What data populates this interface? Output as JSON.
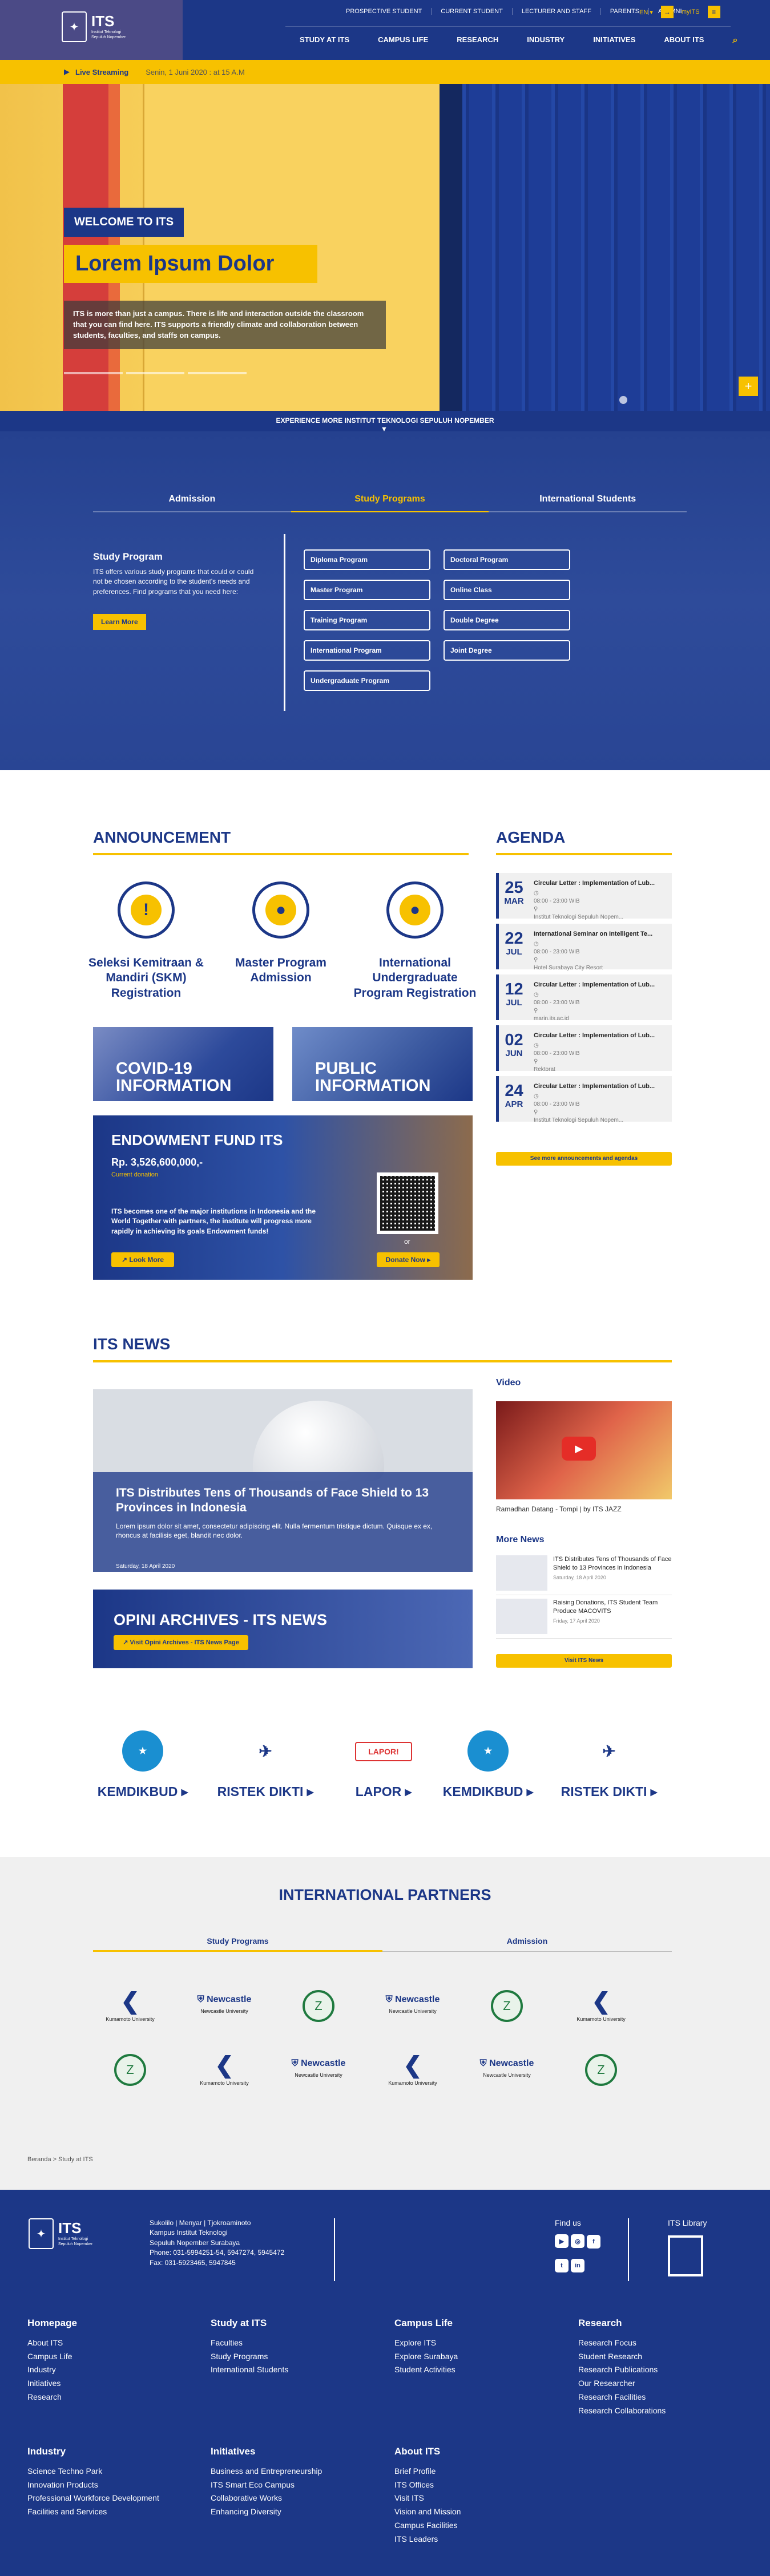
{
  "header": {
    "logo": {
      "text": "ITS",
      "sub": "Institut Teknologi Sepuluh Nopember"
    },
    "top_links": [
      "PROSPECTIVE STUDENT",
      "CURRENT STUDENT",
      "LECTURER AND STAFF",
      "PARENTS",
      "ALUMNI"
    ],
    "lang": "EN",
    "myits": "myITS",
    "main_nav": [
      "STUDY AT ITS",
      "CAMPUS LIFE",
      "RESEARCH",
      "INDUSTRY",
      "INITIATIVES",
      "ABOUT ITS"
    ]
  },
  "live": {
    "label": "Live Streaming",
    "event": "Senin, 1 Juni 2020 : at 15 A.M"
  },
  "hero": {
    "welcome": "WELCOME TO ITS",
    "title": "Lorem Ipsum Dolor",
    "desc": "ITS is more than just a campus. There is life and interaction outside the classroom that you can find here. ITS supports a friendly climate and collaboration between students, faculties, and staffs on campus.",
    "explore": "EXPERIENCE MORE INSTITUT TEKNOLOGI SEPULUH NOPEMBER"
  },
  "programs": {
    "tabs": [
      "Admission",
      "Study Programs",
      "International Students"
    ],
    "title": "Study Program",
    "desc": "ITS offers various study programs that could or could not be chosen according to the student's needs and preferences. Find programs that you need here:",
    "learn": "Learn More",
    "items": [
      "Diploma Program",
      "Doctoral Program",
      "Master Program",
      "Online Class",
      "Training Program",
      "Double Degree",
      "International Program",
      "Joint Degree",
      "Undergraduate Program"
    ]
  },
  "announcement": {
    "title": "ANNOUNCEMENT",
    "items": [
      "Seleksi Kemitraan & Mandiri (SKM) Registration",
      "Master Program Admission",
      "International Undergraduate Program Registration"
    ],
    "cards": [
      "COVID-19 INFORMATION",
      "PUBLIC INFORMATION"
    ]
  },
  "endowment": {
    "title": "ENDOWMENT FUND ITS",
    "amount": "Rp. 3,526,600,000,-",
    "caption": "Current donation",
    "desc": "ITS becomes one of the major institutions in Indonesia and the World Together with partners, the institute will progress more rapidly in achieving its goals Endowment funds!",
    "look": "Look More",
    "or": "or",
    "donate": "Donate Now"
  },
  "agenda": {
    "title": "AGENDA",
    "items": [
      {
        "d": "25",
        "m": "MAR",
        "t": "Circular Letter : Implementation of Lub...",
        "time": "08:00 - 23:00 WIB",
        "loc": "Institut Teknologi Sepuluh Nopem..."
      },
      {
        "d": "22",
        "m": "JUL",
        "t": "International Seminar on Intelligent Te...",
        "time": "08:00 - 23:00 WIB",
        "loc": "Hotel Surabaya City Resort"
      },
      {
        "d": "12",
        "m": "JUL",
        "t": "Circular Letter : Implementation of Lub...",
        "time": "08:00 - 23:00 WIB",
        "loc": "marin.its.ac.id"
      },
      {
        "d": "02",
        "m": "JUN",
        "t": "Circular Letter : Implementation of Lub...",
        "time": "08:00 - 23:00 WIB",
        "loc": "Rektorat"
      },
      {
        "d": "24",
        "m": "APR",
        "t": "Circular Letter : Implementation of Lub...",
        "time": "08:00 - 23:00 WIB",
        "loc": "Institut Teknologi Sepuluh Nopem..."
      }
    ],
    "more": "See more announcements and agendas"
  },
  "news": {
    "title": "ITS NEWS",
    "main_title": "ITS Distributes Tens of Thousands of Face Shield to 13 Provinces in Indonesia",
    "main_desc": "Lorem ipsum dolor sit amet, consectetur adipiscing elit. Nulla fermentum tristique dictum. Quisque ex ex, rhoncus at facilisis eget, blandit nec dolor.",
    "main_date": "Saturday, 18 April 2020",
    "opini": "OPINI ARCHIVES - ITS NEWS",
    "opini_btn": "Visit Opini Archives - ITS News Page",
    "video_title": "Video",
    "video_caption": "Ramadhan Datang - Tompi | by ITS JAZZ",
    "more_title": "More News",
    "more": [
      {
        "t": "ITS Distributes Tens of Thousands of Face Shield to 13 Provinces in Indonesia",
        "d": "Saturday, 18 April 2020"
      },
      {
        "t": "Raising Donations, ITS Student Team Produce MACOVITS",
        "d": "Friday, 17 April 2020"
      }
    ],
    "visit": "Visit ITS News"
  },
  "links": [
    "KEMDIKBUD",
    "RISTEK DIKTI",
    "LAPOR",
    "KEMDIKBUD",
    "RISTEK DIKTI"
  ],
  "partners": {
    "title": "INTERNATIONAL PARTNERS",
    "tabs": [
      "Study Programs",
      "Admission"
    ],
    "row1": [
      "Kumamoto University",
      "Newcastle University",
      "",
      "Newcastle University",
      "",
      "Kumamoto University"
    ],
    "row2": [
      "",
      "Kumamoto University",
      "Newcastle University",
      "Kumamoto University",
      "Newcastle University",
      ""
    ]
  },
  "breadcrumb": "Beranda > Study at ITS",
  "footer": {
    "address": [
      "Sukolilo | Menyar | Tjokroaminoto",
      "Kampus Institut Teknologi",
      "Sepuluh Nopember Surabaya",
      "Phone: 031-5994251-54, 5947274, 5945472",
      "Fax: 031-5923465, 5947845"
    ],
    "findus": "Find us",
    "library": "ITS Library",
    "cols": [
      {
        "h": "Homepage",
        "items": [
          "About ITS",
          "Campus Life",
          "Industry",
          "Initiatives",
          "Research"
        ]
      },
      {
        "h": "Study at ITS",
        "items": [
          "Faculties",
          "Study Programs",
          "International Students"
        ]
      },
      {
        "h": "Campus Life",
        "items": [
          "Explore ITS",
          "Explore Surabaya",
          "Student Activities"
        ]
      },
      {
        "h": "Research",
        "items": [
          "Research Focus",
          "Student Research",
          "Research Publications",
          "Our Researcher",
          "Research Facilities",
          "Research Collaborations"
        ]
      },
      {
        "h": "Industry",
        "items": [
          "Science Techno Park",
          "Innovation Products",
          "Professional Workforce Development",
          "Facilities and Services"
        ]
      },
      {
        "h": "Initiatives",
        "items": [
          "Business and Entrepreneurship",
          "ITS Smart Eco Campus",
          "Collaborative Works",
          "Enhancing Diversity"
        ]
      },
      {
        "h": "About ITS",
        "items": [
          "Brief Profile",
          "ITS Offices",
          "Visit ITS",
          "Vision and Mission",
          "Campus Facilities",
          "ITS Leaders"
        ]
      }
    ]
  }
}
